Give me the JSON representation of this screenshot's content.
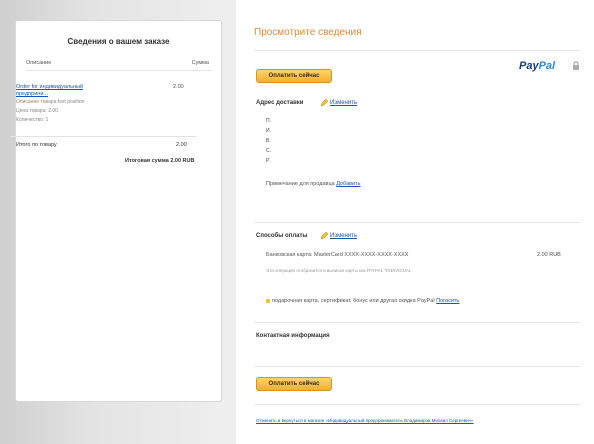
{
  "summary": {
    "title": "Сведения о вашем заказе",
    "col_desc": "Описание",
    "col_amount": "Сумма",
    "item": {
      "name_line1": "Order for индивидуальный",
      "name_line2": "предприни...",
      "amount": "2.00",
      "details": [
        "Описание товара:test position",
        "Цена товара: 2.00",
        "Количество: 1"
      ]
    },
    "item_total_label": "Итого по товару",
    "item_total_value": "2.00",
    "grand_total": "Итоговая сумма 2.00 RUB"
  },
  "review": {
    "title": "Просмотрите сведения",
    "pay_button_label": "Оплатить сейчас",
    "logo_part1": "Pay",
    "logo_part2": "Pal",
    "shipping": {
      "title": "Адрес доставки",
      "edit_label": "Изменить",
      "lines": [
        "П.",
        "И.",
        "В.",
        "С.",
        "Р."
      ],
      "note_text": "Примечание для продавца",
      "note_link": "Добавить"
    },
    "payment": {
      "title": "Способы оплаты",
      "edit_label": "Изменить",
      "card_text": "Банковская карта: MasterCard XXXX-XXXX-XXXX-XXXX",
      "card_amount": "2.00 RUB",
      "card_sub": "Эта операция отобразится в выписке карты как PAYPAL *INDIVIDUAL",
      "gift_text": "подарочная карта, сертификат, бонус или другая скидка PayPal",
      "gift_link": "Погасить"
    },
    "contact": {
      "title": "Контактная информация"
    },
    "footer_link": "Отменить и вернуться в магазин «Индивидуальный предприниматель Владимиров Михаил Сергеевич»"
  },
  "colors": {
    "accent_orange": "#d98a3a",
    "button_yellow": "#f3b02a",
    "link_blue": "#1a57a8",
    "paypal_dark": "#1a3a7a",
    "paypal_light": "#2a8ad6"
  }
}
